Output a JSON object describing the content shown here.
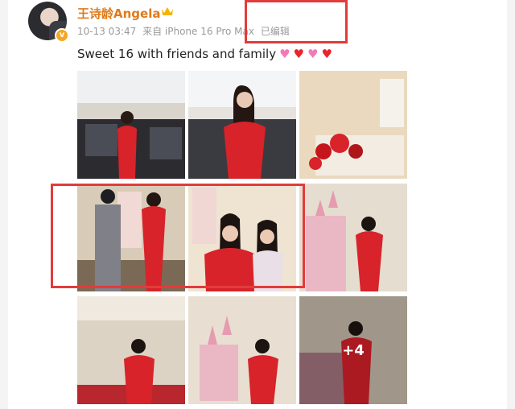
{
  "post": {
    "username": "王诗龄Angela",
    "verified_icon": "v-badge-icon",
    "crown_icon": "crown-icon",
    "date": "10-13 03:47",
    "source": "来自 iPhone 16 Pro Max",
    "edited": "已编辑",
    "caption": "Sweet 16 with friends and family",
    "hearts": [
      "#f27ab8",
      "#e8242c",
      "#f27ab8",
      "#e8242c"
    ],
    "more_count": "+4"
  },
  "colors": {
    "username": "#e07a1a",
    "annotation_red": "#e23b3b",
    "dress_red": "#d8232a"
  }
}
